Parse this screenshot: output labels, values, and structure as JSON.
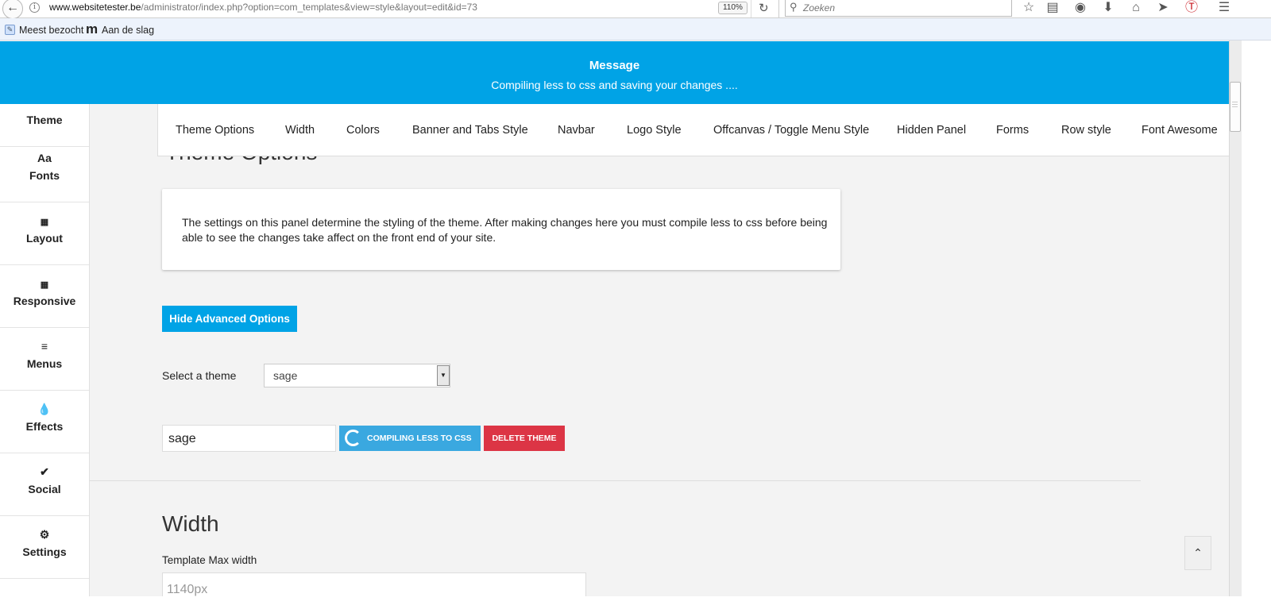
{
  "browser": {
    "url_host": "www.websitetester.be",
    "url_path": "/administrator/index.php?option=com_templates&view=style&layout=edit&id=73",
    "zoom": "110%",
    "search_placeholder": "Zoeken",
    "toolbar_icons": [
      "star-icon",
      "reading-list-icon",
      "pocket-icon",
      "download-icon",
      "home-icon",
      "send-icon",
      "pinterest-icon",
      "menu-icon"
    ],
    "bookmarks": [
      {
        "label": "Meest bezocht",
        "icon": "bookmark-folder-icon"
      },
      {
        "label": "Aan de slag",
        "icon": "m-logo-icon"
      }
    ]
  },
  "message": {
    "title": "Message",
    "text": "Compiling less to css and saving your changes ...."
  },
  "sidebar": {
    "items": [
      {
        "label": "Theme",
        "icon": "theme-icon"
      },
      {
        "label": "Fonts",
        "icon_text": "Aa",
        "icon": "fonts-icon"
      },
      {
        "label": "Layout",
        "icon": "layout-grid-icon"
      },
      {
        "label": "Responsive",
        "icon": "responsive-grid-icon"
      },
      {
        "label": "Menus",
        "icon": "menu-bars-icon"
      },
      {
        "label": "Effects",
        "icon": "droplets-icon"
      },
      {
        "label": "Social",
        "icon": "twitter-bird-icon"
      },
      {
        "label": "Settings",
        "icon": "gear-icon"
      }
    ]
  },
  "tabs": [
    "Theme Options",
    "Width",
    "Colors",
    "Banner and Tabs Style",
    "Navbar",
    "Logo Style",
    "Offcanvas / Toggle Menu Style",
    "Hidden Panel",
    "Forms",
    "Row style",
    "Font Awesome"
  ],
  "theme_options": {
    "heading": "Theme Options",
    "intro": "The settings on this panel determine the styling of the theme. After making changes here you must compile less to css before being able to see the changes take affect on the front end of your site.",
    "hide_advanced_label": "Hide Advanced Options",
    "select_theme_label": "Select a theme",
    "selected_theme": "sage",
    "theme_name_value": "sage",
    "compile_label": "COMPILING LESS TO CSS",
    "delete_label": "DELETE THEME"
  },
  "width_section": {
    "heading": "Width",
    "max_width_label": "Template Max width",
    "max_width_value": "1140px"
  },
  "colors": {
    "accent": "#00a3e6",
    "danger": "#dc3545",
    "background": "#f3f3f3"
  }
}
